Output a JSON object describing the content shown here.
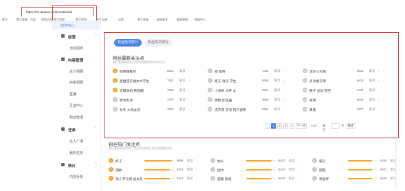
{
  "browser": {
    "url": "https://we.taobao.com/creative/all"
  },
  "bookmarks": [
    "数字",
    "数字管理",
    "百度",
    "商家后台",
    "数字管理",
    "数字营销",
    "数字运营",
    "运营",
    "数字管理",
    "数据参考",
    "数据管理",
    "数据中心"
  ],
  "sidebar": {
    "active_item": "创作中心",
    "groups": [
      {
        "label": "经营",
        "items": [
          "活动招商"
        ]
      },
      {
        "label": "内容管理",
        "items": [
          "达人招募",
          "商家招募",
          "直播",
          "互动中心",
          "粉丝管理"
        ]
      },
      {
        "label": "任务",
        "items": [
          "达人广场",
          "我的任务"
        ]
      },
      {
        "label": "统计",
        "items": [
          "内容分析"
        ]
      }
    ]
  },
  "panel": {
    "tabs": [
      "粉丝热词排行",
      "粉丝热文排行"
    ],
    "title": "粉丝最新关注点",
    "subtitle": "每日更新粉丝在产品中的最新热词和关注点",
    "link_label": "解读",
    "rows": [
      {
        "rank": "1",
        "name": "防晒霜推荐",
        "value": "8624"
      },
      {
        "rank": "2",
        "name": "显瘦连衣裙女大学生",
        "value": "7401"
      },
      {
        "rank": "3",
        "name": "衣服收纳 整理箱",
        "value": "7392"
      },
      {
        "rank": "4",
        "name": "卸妆乳液",
        "value": "7379"
      },
      {
        "rank": "5",
        "name": "秋冬 大码女装",
        "value": "7344"
      },
      {
        "rank": "6",
        "name": "短 家用",
        "value": "7344"
      },
      {
        "rank": "7",
        "name": "夏天 清凉 学生",
        "value": "6948"
      },
      {
        "rank": "8",
        "name": "小清新 水杯 女",
        "value": "6912"
      },
      {
        "rank": "9",
        "name": "便携 加湿器",
        "value": "6856"
      },
      {
        "rank": "10",
        "name": "洗衣液 去渍 持久留香",
        "value": "6652"
      },
      {
        "rank": "11",
        "name": "迷你小风扇",
        "value": "6619"
      },
      {
        "rank": "12",
        "name": "多功能衣架",
        "value": "6615"
      },
      {
        "rank": "13",
        "name": "鞋子 运动 镂空",
        "value": "6737"
      },
      {
        "rank": "14",
        "name": "家用",
        "value": "6642"
      },
      {
        "rank": "15",
        "name": "耳塞",
        "value": "6577"
      }
    ],
    "pagination": {
      "pages": [
        "1",
        "2",
        "3",
        "4"
      ],
      "next": "下一页",
      "total": "1/15",
      "goto": "跳至",
      "page_unit": "页",
      "confirm": "确定"
    }
  },
  "section2": {
    "title": "粉丝热门关注点",
    "subtitle": "每日更新粉丝在热门关注点中的热门关注和趋势排名",
    "link_label": "解读",
    "rows": [
      {
        "rank": "1",
        "name": "杯子",
        "value": "9656",
        "fill": 0.9
      },
      {
        "rank": "2",
        "name": "抱枕",
        "value": "9441",
        "fill": 0.85
      },
      {
        "rank": "3",
        "name": "情人节礼物 送女友",
        "value": "9437",
        "fill": 0.84
      },
      {
        "rank": "4",
        "name": "枕头",
        "value": "9423",
        "fill": 0.83
      },
      {
        "rank": "5",
        "name": "围巾",
        "value": "9423",
        "fill": 0.83
      },
      {
        "rank": "6",
        "name": "面膜 套组",
        "value": "9419",
        "fill": 0.82
      },
      {
        "rank": "7",
        "name": "帽子",
        "value": "9344",
        "fill": 0.8
      },
      {
        "rank": "8",
        "name": "拖鞋",
        "value": "9341",
        "fill": 0.8
      },
      {
        "rank": "9",
        "name": "保温杯",
        "value": "9333",
        "fill": 0.79
      }
    ]
  },
  "colors": {
    "accent": "#4e83e6",
    "highlight_border": "#d63a3a",
    "rank_top": "#f5a623",
    "rank_other": "#c8c8c8"
  }
}
